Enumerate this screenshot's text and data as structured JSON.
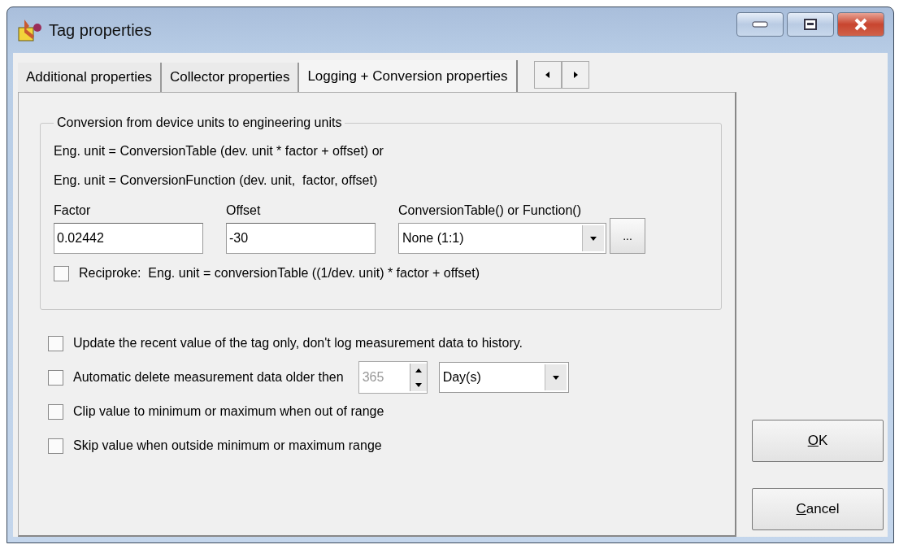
{
  "window": {
    "title": "Tag properties"
  },
  "tabs": [
    {
      "label": "Additional properties",
      "selected": false
    },
    {
      "label": "Collector properties",
      "selected": false
    },
    {
      "label": "Logging + Conversion properties",
      "selected": true
    }
  ],
  "conversion": {
    "title": "Conversion from device units to engineering units",
    "formulas": [
      "Eng. unit = ConversionTable (dev. unit * factor + offset) or",
      "Eng. unit = ConversionFunction (dev. unit,  factor, offset)"
    ],
    "factor": {
      "label": "Factor",
      "value": "0.02442"
    },
    "offset": {
      "label": "Offset",
      "value": "-30"
    },
    "table": {
      "label": "ConversionTable() or Function()",
      "value": "None (1:1)",
      "browse": "..."
    },
    "reciproke": {
      "label": "Reciproke:  Eng. unit = conversionTable ((1/dev. unit) * factor + offset)",
      "checked": false
    }
  },
  "options": [
    {
      "kind": "plain",
      "label": "Update the recent value of the tag only, don't log measurement data to history.",
      "checked": false
    },
    {
      "kind": "retention",
      "label": "Automatic delete measurement data older then",
      "checked": false,
      "amount": {
        "value": "365",
        "disabled": true
      },
      "unit": "Day(s)"
    },
    {
      "kind": "plain",
      "label": "Clip value to minimum or maximum when out of range",
      "checked": false
    },
    {
      "kind": "plain",
      "label": "Skip value when outside minimum or maximum range",
      "checked": false
    }
  ],
  "buttons": [
    {
      "label": "OK"
    },
    {
      "label": "Cancel"
    }
  ]
}
